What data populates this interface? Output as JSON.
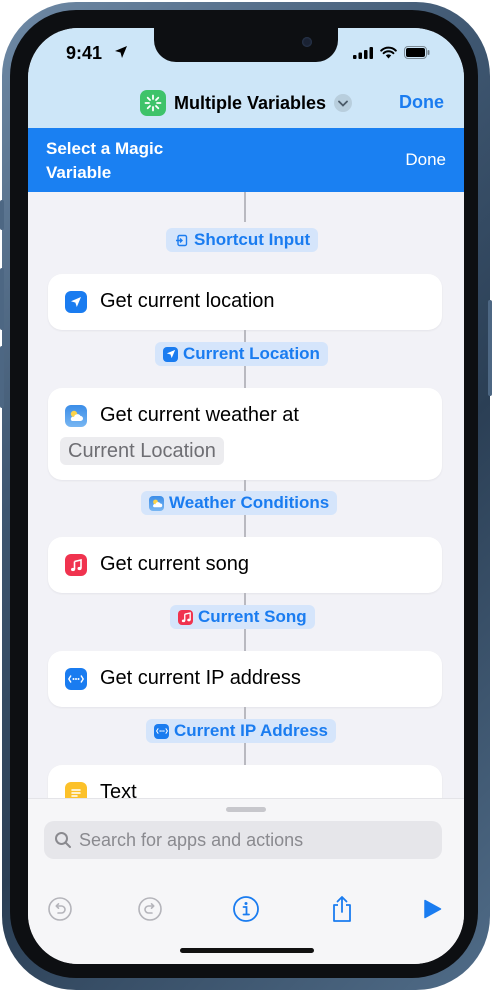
{
  "status_bar": {
    "time": "9:41"
  },
  "nav": {
    "title": "Multiple Variables",
    "done_label": "Done"
  },
  "magic_banner": {
    "title": "Select a Magic Variable",
    "done_label": "Done"
  },
  "chips": {
    "shortcut_input": "Shortcut Input",
    "current_location": "Current Location",
    "weather_conditions": "Weather Conditions",
    "current_song": "Current Song",
    "current_ip": "Current IP Address"
  },
  "actions": {
    "location": {
      "label": "Get current location",
      "icon": "location-arrow-icon",
      "color": "#1a7cf0"
    },
    "weather": {
      "label": "Get current weather at",
      "param": "Current Location",
      "icon": "weather-icon",
      "color": "#4a9ae8"
    },
    "song": {
      "label": "Get current song",
      "icon": "music-note-icon",
      "color": "#f0334f"
    },
    "ip": {
      "label": "Get current IP address",
      "icon": "network-icon",
      "color": "#1a7cf0"
    },
    "text": {
      "label": "Text",
      "icon": "text-note-icon",
      "color": "#fcc12a"
    }
  },
  "search": {
    "placeholder": "Search for apps and actions"
  },
  "toolbar": {
    "undo": "undo-icon",
    "redo": "redo-icon",
    "info": "info-icon",
    "share": "share-icon",
    "run": "play-icon"
  },
  "colors": {
    "accent": "#1a7cf0",
    "banner": "#1a80f2",
    "header": "#cde6f8",
    "chip_bg": "#d5e5fb"
  }
}
